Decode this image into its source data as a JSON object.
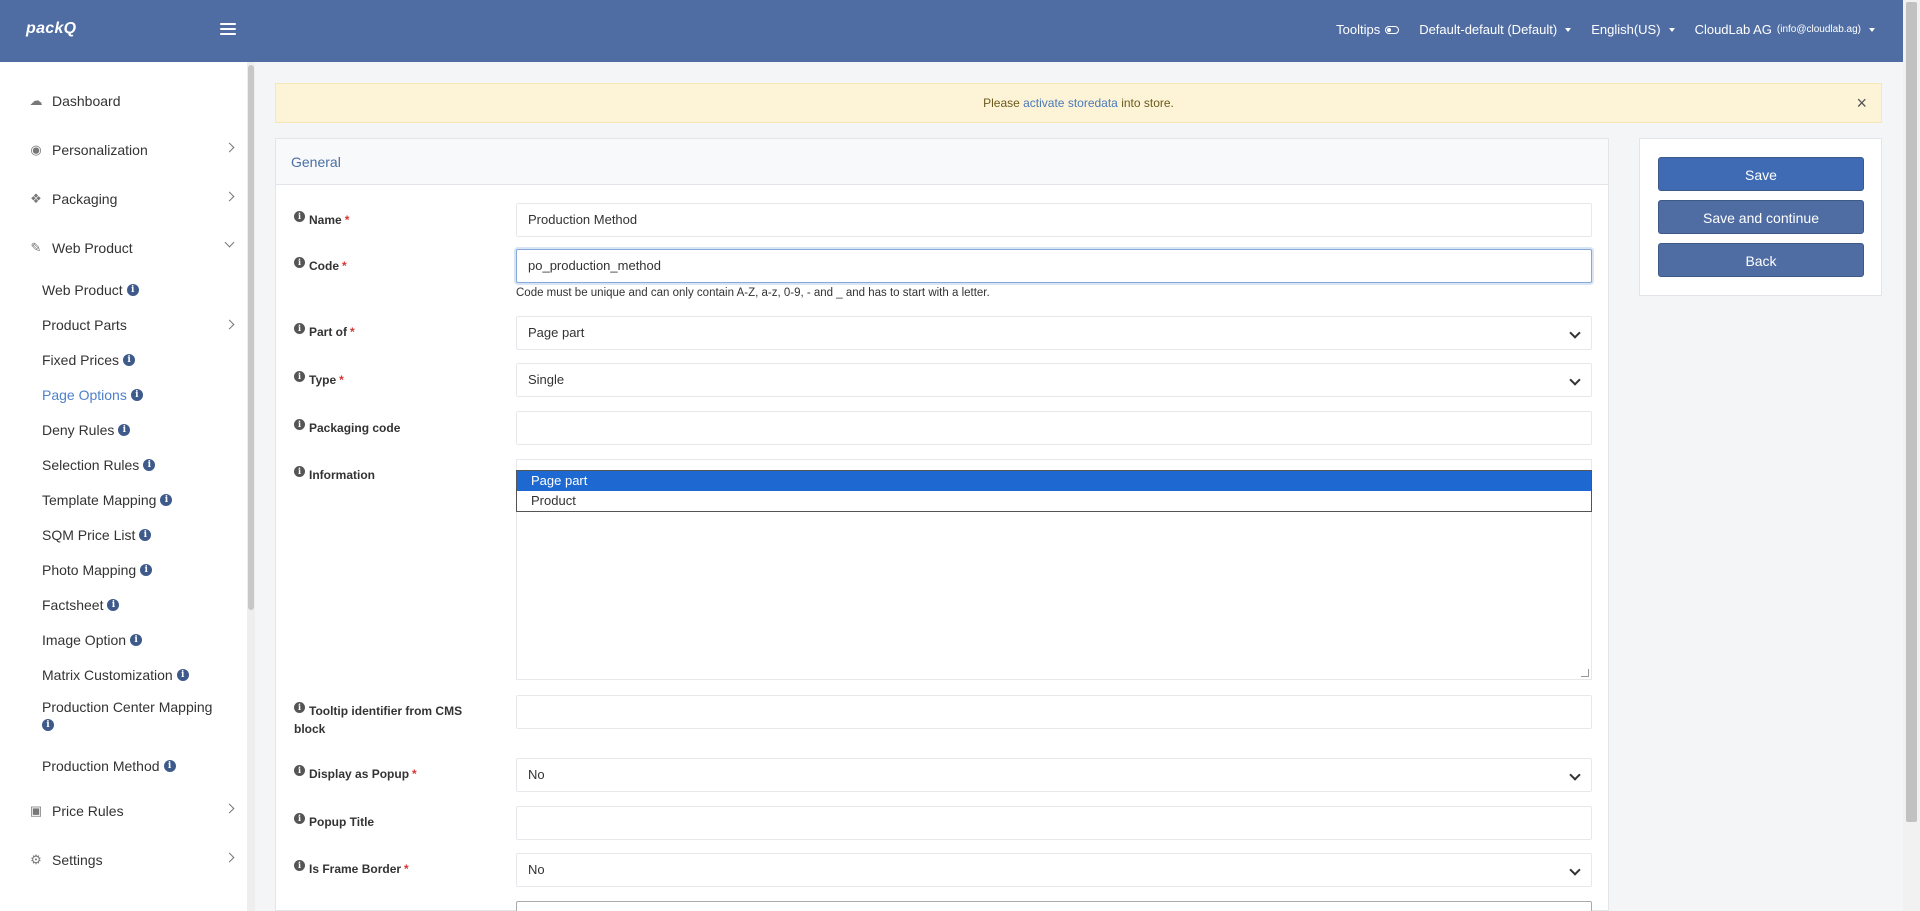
{
  "header": {
    "logo": "packQ",
    "tooltips_label": "Tooltips",
    "store": "Default-default (Default)",
    "language": "English(US)",
    "account_name": "CloudLab AG",
    "account_email": "(info@cloudlab.ag)"
  },
  "sidebar": {
    "dashboard": "Dashboard",
    "personalization": "Personalization",
    "packaging": "Packaging",
    "web_product": "Web Product",
    "sub_items": [
      "Web Product",
      "Product Parts",
      "Fixed Prices",
      "Page Options",
      "Deny Rules",
      "Selection Rules",
      "Template Mapping",
      "SQM Price List",
      "Photo Mapping",
      "Factsheet",
      "Image Option",
      "Matrix Customization",
      "Production Center Mapping",
      "Production Method"
    ],
    "price_rules": "Price Rules",
    "settings": "Settings"
  },
  "alert": {
    "prefix": "Please ",
    "link": "activate storedata",
    "suffix": " into store.",
    "close": "×"
  },
  "form": {
    "section_title": "General",
    "name_label": "Name",
    "name_value": "Production Method",
    "code_label": "Code",
    "code_value": "po_production_method",
    "code_help": "Code must be unique and can only contain A-Z, a-z, 0-9, - and _ and has to start with a letter.",
    "part_of_label": "Part of",
    "part_of_value": "Page part",
    "type_label": "Type",
    "type_value": "Single",
    "packaging_code_label": "Packaging code",
    "information_label": "Information",
    "dropdown_options": [
      "Page part",
      "Product"
    ],
    "tooltip_label_1": "Tooltip identifier from CMS",
    "tooltip_label_2": "block",
    "display_popup_label": "Display as Popup",
    "display_popup_value": "No",
    "popup_title_label": "Popup Title",
    "frame_border_label": "Is Frame Border",
    "frame_border_value": "No",
    "required_mark": "*"
  },
  "actions": {
    "save": "Save",
    "save_continue": "Save and continue",
    "back": "Back"
  }
}
